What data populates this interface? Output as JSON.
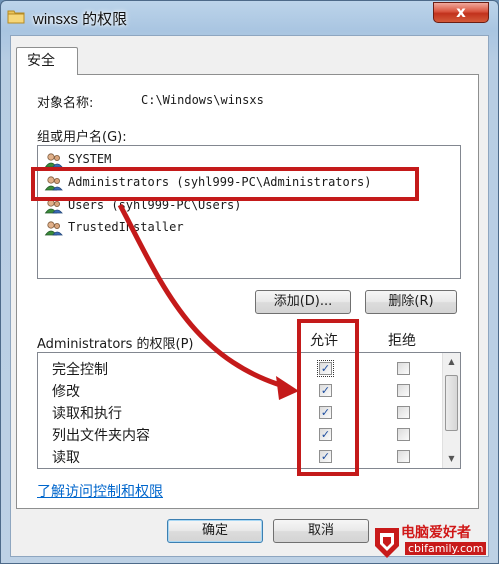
{
  "window": {
    "title": "winsxs 的权限",
    "close_glyph": "x"
  },
  "tab": {
    "label": "安全"
  },
  "object": {
    "label": "对象名称:",
    "value": "C:\\Windows\\winsxs"
  },
  "groups": {
    "label": "组或用户名(G):",
    "items": [
      {
        "name": "SYSTEM"
      },
      {
        "name": "Administrators (syhl999-PC\\Administrators)",
        "selected": true
      },
      {
        "name": "Users (syhl999-PC\\Users)"
      },
      {
        "name": "TrustedInstaller"
      }
    ]
  },
  "buttons": {
    "add": "添加(D)...",
    "remove": "删除(R)",
    "ok": "确定",
    "cancel": "取消"
  },
  "permissions": {
    "label": "Administrators 的权限(P)",
    "allow_header": "允许",
    "deny_header": "拒绝",
    "rows": [
      {
        "name": "完全控制",
        "allow": true,
        "deny": false
      },
      {
        "name": "修改",
        "allow": true,
        "deny": false
      },
      {
        "name": "读取和执行",
        "allow": true,
        "deny": false
      },
      {
        "name": "列出文件夹内容",
        "allow": true,
        "deny": false
      },
      {
        "name": "读取",
        "allow": true,
        "deny": false
      }
    ]
  },
  "link": {
    "text": "了解访问控制和权限"
  },
  "watermark": {
    "main": "电脑爱好者",
    "sub": "cbifamily.com"
  },
  "colors": {
    "annotation_red": "#c41a1a",
    "link_blue": "#0066cc",
    "title_gradient": "#a9c5e1"
  },
  "icons": {
    "window": "folder-icon",
    "user": "users-group-icon",
    "check": "checkmark-icon"
  }
}
